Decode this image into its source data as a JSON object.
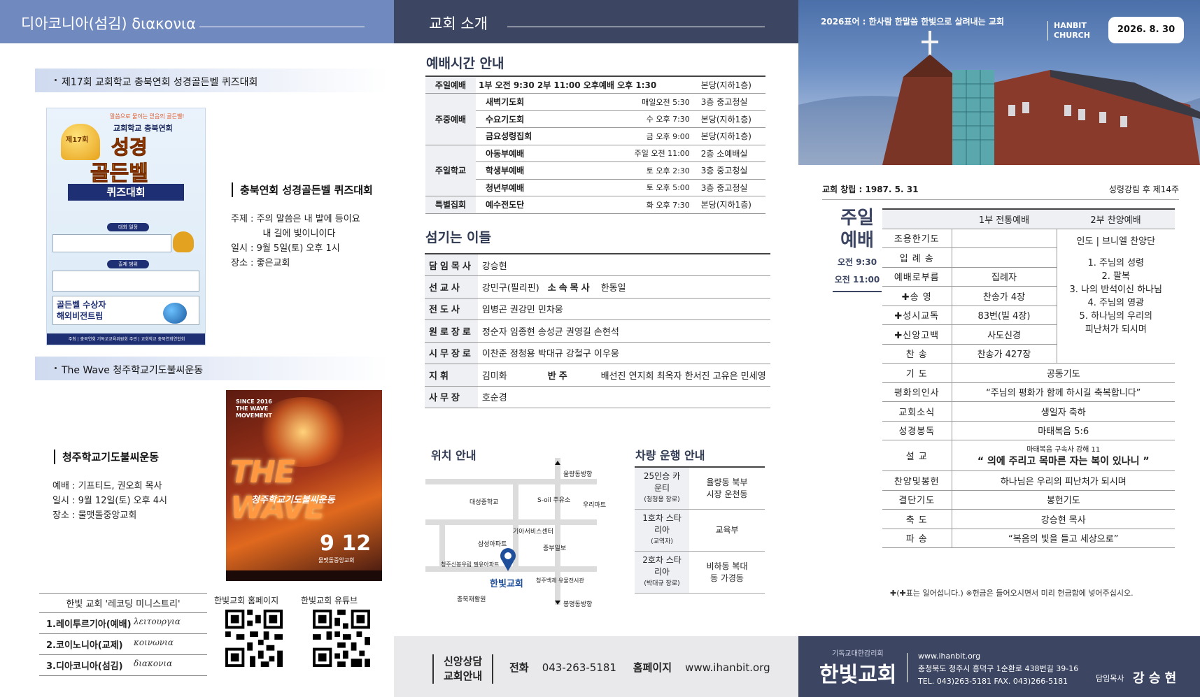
{
  "left": {
    "header": "디아코니아(섬김) διακονια",
    "section1_title": "제17회 교회학교 충북연회 성경골든벨 퀴즈대회",
    "poster1": {
      "tagline": "말씀으로 물이는 믿음의 골든벨!",
      "edition": "제17회",
      "org": "교회학교 충북연회",
      "title1": "성경",
      "title2": "골든벨",
      "title3": "퀴즈대회",
      "schedule_label": "대회 일정",
      "range_label": "출제 범위",
      "prize_line1": "골든벨 수상자",
      "prize_line2": "해외비전트립",
      "footer": "주최 | 충북연회 기독교교육위원회   주관 | 교회학교 충북연회연합회"
    },
    "event1": {
      "heading": "충북연회 성경골든벨 퀴즈대회",
      "lines": [
        "주제 : 주의 말씀은 내 발에 등이요",
        "           내 길에 빛이니이다",
        "일시 : 9월 5일(토) 오후 1시",
        "장소 : 좋은교회"
      ]
    },
    "section2_title": "The Wave 청주학교기도불씨운동",
    "poster2": {
      "top": "SINCE 2016 THE WAVE MOVEMENT",
      "big": "THE WAVE",
      "sub": "청주학교기도불씨운동",
      "date": "9 12",
      "place": "물맷돌중앙교회"
    },
    "event2": {
      "heading": "청주학교기도불씨운동",
      "lines": [
        "예배 : 기프티드, 권오희 목사",
        "일시 : 9월 12일(토) 오후 4시",
        "장소 : 물맷돌중앙교회"
      ]
    },
    "ministry": {
      "header": "한빛 교회 '레코딩 미니스트리'",
      "rows": [
        {
          "ko": "1.레이투르기아(예배)",
          "gr": "λειτουργια"
        },
        {
          "ko": "2.코이노니아(교제)",
          "gr": "κοινωνια"
        },
        {
          "ko": "3.디아코니아(섬김)",
          "gr": "διακονια"
        }
      ]
    },
    "qr1_label": "한빛교회 홈페이지",
    "qr2_label": "한빛교회 유튜브"
  },
  "middle": {
    "header": "교회 소개",
    "worship_title": "예배시간 안내",
    "worship_rows": [
      {
        "cat": "주일예배",
        "rs": 1,
        "name": "1부 오전 9:30  2부 11:00  오후예배 오후 1:30",
        "time": "",
        "place": "본당(지하1층)"
      },
      {
        "cat": "주중예배",
        "rs": 3,
        "name": "새벽기도회",
        "time": "매일오전 5:30",
        "place": "3층 중고청실"
      },
      {
        "cat": "",
        "rs": 0,
        "name": "수요기도회",
        "time": "수 오후 7:30",
        "place": "본당(지하1층)"
      },
      {
        "cat": "",
        "rs": 0,
        "name": "금요성령집회",
        "time": "금 오후 9:00",
        "place": "본당(지하1층)"
      },
      {
        "cat": "주일학교",
        "rs": 3,
        "name": "아동부예배",
        "time": "주일 오전 11:00",
        "place": "2층 소예배실"
      },
      {
        "cat": "",
        "rs": 0,
        "name": "학생부예배",
        "time": "토 오후 2:30",
        "place": "3층 중고청실"
      },
      {
        "cat": "",
        "rs": 0,
        "name": "청년부예배",
        "time": "토 오후 5:00",
        "place": "3층 중고청실"
      },
      {
        "cat": "특별집회",
        "rs": 1,
        "name": "예수전도단",
        "time": "화 오후 7:30",
        "place": "본당(지하1층)"
      }
    ],
    "staff_title": "섬기는 이들",
    "staff": [
      {
        "k": "담임목사",
        "v": "강승현",
        "k2": "",
        "v2": ""
      },
      {
        "k": "선교사",
        "v": "강민구(필리핀)",
        "k2": "소속목사",
        "v2": "한동일"
      },
      {
        "k": "전도사",
        "v": "임병곤 권강민 민차웅",
        "k2": "",
        "v2": ""
      },
      {
        "k": "원로장로",
        "v": "정순자 임종현 송성균 권영길 손현석",
        "k2": "",
        "v2": ""
      },
      {
        "k": "시무장로",
        "v": "이찬준 정청용 박대규 강철구 이우웅",
        "k2": "",
        "v2": ""
      },
      {
        "k": "지휘",
        "v": "김미화",
        "k2": "반주",
        "v2": "배선진 연지희 최옥자 한서진 고유은 민세영"
      },
      {
        "k": "사무장",
        "v": "호순경",
        "k2": "",
        "v2": ""
      }
    ],
    "map_title": "위치 안내",
    "map_labels": [
      "울량동방향",
      "대성중학교",
      "S-oil 주유소",
      "우리마트",
      "기아서비스센터",
      "삼성아파트",
      "중부일보",
      "청주신봉우림 필유아파트",
      "한빛교회",
      "청주백제 유물전시관",
      "충북재활원",
      "봉명동방향"
    ],
    "bus_title": "차량 운행 안내",
    "bus_rows": [
      {
        "k": "25인승 카운티",
        "sub": "(청청용 장로)",
        "v": "율량동 북부시장 운천동"
      },
      {
        "k": "1호차 스타리아",
        "sub": "(교역자)",
        "v": "교육부"
      },
      {
        "k": "2호차 스타리아",
        "sub": "(박대규 장로)",
        "v": "비하동 복대동 가경동"
      }
    ],
    "footer": {
      "label1": "신앙상담",
      "label2": "교회안내",
      "phone_k": "전화",
      "phone": "043-263-5181",
      "web_k": "홈페이지",
      "web": "www.ihanbit.org"
    }
  },
  "right": {
    "motto": "2026표어 : 한사람 한말씀 한빛으로 살려내는 교회",
    "hanbit": "HANBIT",
    "church": "CHURCH",
    "date": "2026. 8. 30",
    "founded": "교회 창립 : 1987. 5. 31",
    "season": "성령강림 후 제14주",
    "service_title1": "주일",
    "service_title2": "예배",
    "service_time1": "오전 9:30",
    "service_time2": "오전 11:00",
    "col1": "1부 전통예배",
    "col2": "2부 찬양예배",
    "order_rows": [
      {
        "k": "조용한기도",
        "v": ""
      },
      {
        "k": "입 례 송",
        "v": ""
      },
      {
        "k": "예배로부름",
        "v": "집례자"
      },
      {
        "k": "✚송    영",
        "v": "찬송가 4장"
      },
      {
        "k": "✚성시교독",
        "v": "83번(빌 4장)"
      },
      {
        "k": "✚신앙고백",
        "v": "사도신경"
      },
      {
        "k": "찬      송",
        "v": "찬송가 427장"
      }
    ],
    "praise": [
      "인도 | 브니엘 찬양단",
      "1. 주님의 성령",
      "2. 팔복",
      "3. 나의 반석이신 하나님",
      "4. 주님의 영광",
      "5. 하나님의 우리의",
      "피난처가 되시며"
    ],
    "full_rows": [
      {
        "k": "기      도",
        "v": "공동기도"
      },
      {
        "k": "평화의인사",
        "v": "“주님의 평화가 함께 하시길 축복합니다”"
      },
      {
        "k": "교회소식",
        "v": "생일자 축하"
      },
      {
        "k": "성경봉독",
        "v": "마태복음 5:6"
      }
    ],
    "sermon_k": "설      교",
    "sermon_ref": "마태복음 구속사 강해 11",
    "sermon_title": "“ 의에 주리고 목마른 자는 복이 있나니 ”",
    "rows2": [
      {
        "k": "찬양및봉헌",
        "v": "하나님은 우리의 피난처가 되시며"
      },
      {
        "k": "결단기도",
        "v": "봉헌기도"
      },
      {
        "k": "축      도",
        "v": "강승현 목사"
      },
      {
        "k": "파      송",
        "v": "“복음의 빛을 들고 세상으로”"
      }
    ],
    "note": "✚(✚표는 일어섭니다.) ※헌금은 들어오시면서 미리 헌금함에 넣어주십시오.",
    "footer": {
      "denom": "기독교대한감리회",
      "name": "한빛교회",
      "web": "www.ihanbit.org",
      "addr": "충청북도 청주시 흥덕구 1순환로 438번길 39-16",
      "tel": "TEL. 043)263-5181   FAX. 043)266-5181",
      "pastor_k": "담임목사",
      "pastor": "강 승 현"
    }
  }
}
